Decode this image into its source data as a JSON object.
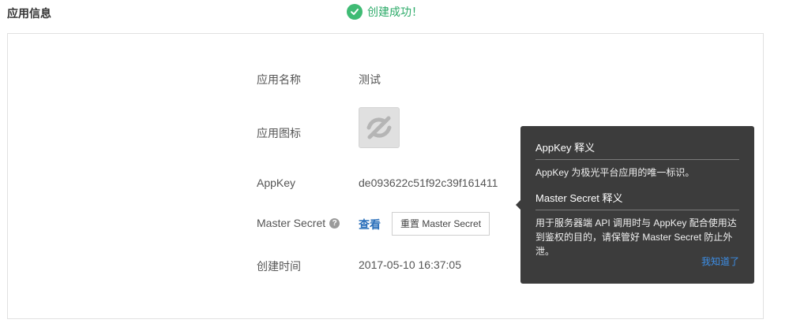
{
  "header": {
    "title": "应用信息",
    "success_message": "创建成功！",
    "success_icon": "check-circle-icon"
  },
  "colors": {
    "success": "#2eab6a",
    "link": "#2a6fba",
    "tooltip_bg": "#3c3c3c",
    "tooltip_link": "#3d8ee6"
  },
  "app": {
    "name_label": "应用名称",
    "name_value": "测试",
    "icon_label": "应用图标",
    "icon_name": "app-placeholder-icon",
    "appkey_label": "AppKey",
    "appkey_value": "de093622c51f92c39f161411",
    "secret_label": "Master Secret",
    "help_icon": "?",
    "view_link": "查看",
    "reset_button": "重置 Master Secret",
    "created_label": "创建时间",
    "created_value": "2017-05-10 16:37:05"
  },
  "tooltip": {
    "appkey_title": "AppKey 释义",
    "appkey_desc": "AppKey 为极光平台应用的唯一标识。",
    "secret_title": "Master Secret 释义",
    "secret_desc": "用于服务器端 API 调用时与 AppKey 配合使用达到鉴权的目的，请保管好 Master Secret 防止外泄。",
    "ok_link": "我知道了"
  }
}
